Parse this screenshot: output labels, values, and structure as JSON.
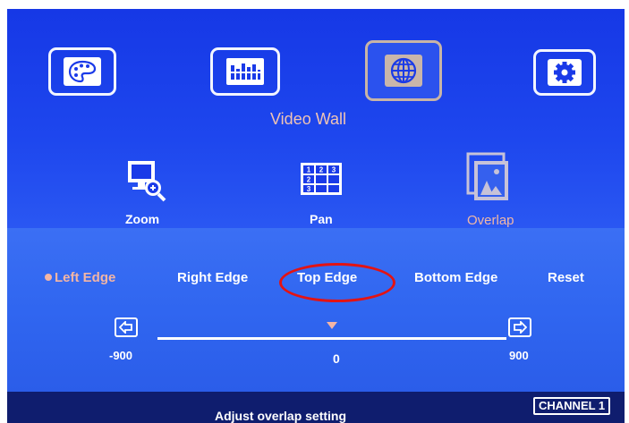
{
  "top_icons": [
    {
      "icon": "palette-icon",
      "selected": false
    },
    {
      "icon": "equalizer-icon",
      "selected": false
    },
    {
      "icon": "globe-icon",
      "selected": true
    },
    {
      "icon": "gear-icon",
      "selected": false
    }
  ],
  "section_title": "Video Wall",
  "sub_menu": [
    {
      "label": "Zoom",
      "icon": "zoom-monitor-icon",
      "selected": false
    },
    {
      "label": "Pan",
      "icon": "grid-icon",
      "selected": false
    },
    {
      "label": "Overlap",
      "icon": "overlap-picture-icon",
      "selected": true
    }
  ],
  "edge_options": [
    {
      "label": "Left Edge",
      "selected": true
    },
    {
      "label": "Right Edge",
      "selected": false
    },
    {
      "label": "Top Edge",
      "selected": false,
      "highlighted": true
    },
    {
      "label": "Bottom Edge",
      "selected": false
    },
    {
      "label": "Reset",
      "selected": false
    }
  ],
  "slider": {
    "min": "-900",
    "max": "900",
    "value": "0",
    "position": 0.5
  },
  "channel_badge": "CHANNEL 1",
  "status_text": "Adjust overlap setting",
  "colors": {
    "background": "#1a3ae8",
    "selected_text": "#f0b7a6",
    "highlight_ring": "#e31313"
  }
}
